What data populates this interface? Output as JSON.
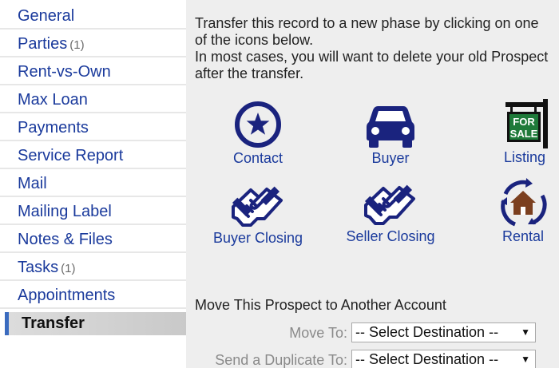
{
  "sidebar": {
    "items": [
      {
        "label": "General"
      },
      {
        "label": "Parties",
        "count": "(1)"
      },
      {
        "label": "Rent-vs-Own"
      },
      {
        "label": "Max Loan"
      },
      {
        "label": "Payments"
      },
      {
        "label": "Service Report"
      },
      {
        "label": "Mail"
      },
      {
        "label": "Mailing Label"
      },
      {
        "label": "Notes & Files"
      },
      {
        "label": "Tasks",
        "count": "(1)"
      },
      {
        "label": "Appointments"
      },
      {
        "label": "Transfer",
        "active": true
      }
    ]
  },
  "main": {
    "intro_line1": "Transfer this record to a new phase by clicking on one of the icons below.",
    "intro_line2": "In most cases, you will want to delete your old Prospect after the transfer.",
    "phases": [
      {
        "label": "Contact",
        "icon": "star-circle-icon"
      },
      {
        "label": "Buyer",
        "icon": "car-icon"
      },
      {
        "label": "Listing",
        "icon": "for-sale-sign-icon",
        "icon_text": [
          "FOR",
          "SALE"
        ]
      },
      {
        "label": "Buyer Closing",
        "icon": "handshake-icon"
      },
      {
        "label": "Seller Closing",
        "icon": "handshake-icon"
      },
      {
        "label": "Rental",
        "icon": "house-cycle-icon"
      }
    ],
    "move_title": "Move This Prospect to Another Account",
    "move_to": {
      "label": "Move To:",
      "value": "-- Select Destination --"
    },
    "duplicate_to": {
      "label": "Send a Duplicate To:",
      "value": "-- Select Destination --"
    }
  },
  "colors": {
    "link": "#1a3a9c",
    "icon_navy": "#1a237e",
    "sale_green": "#1f7a3a",
    "house_brown": "#7b3f1f",
    "panel_bg": "#eeeeee"
  }
}
